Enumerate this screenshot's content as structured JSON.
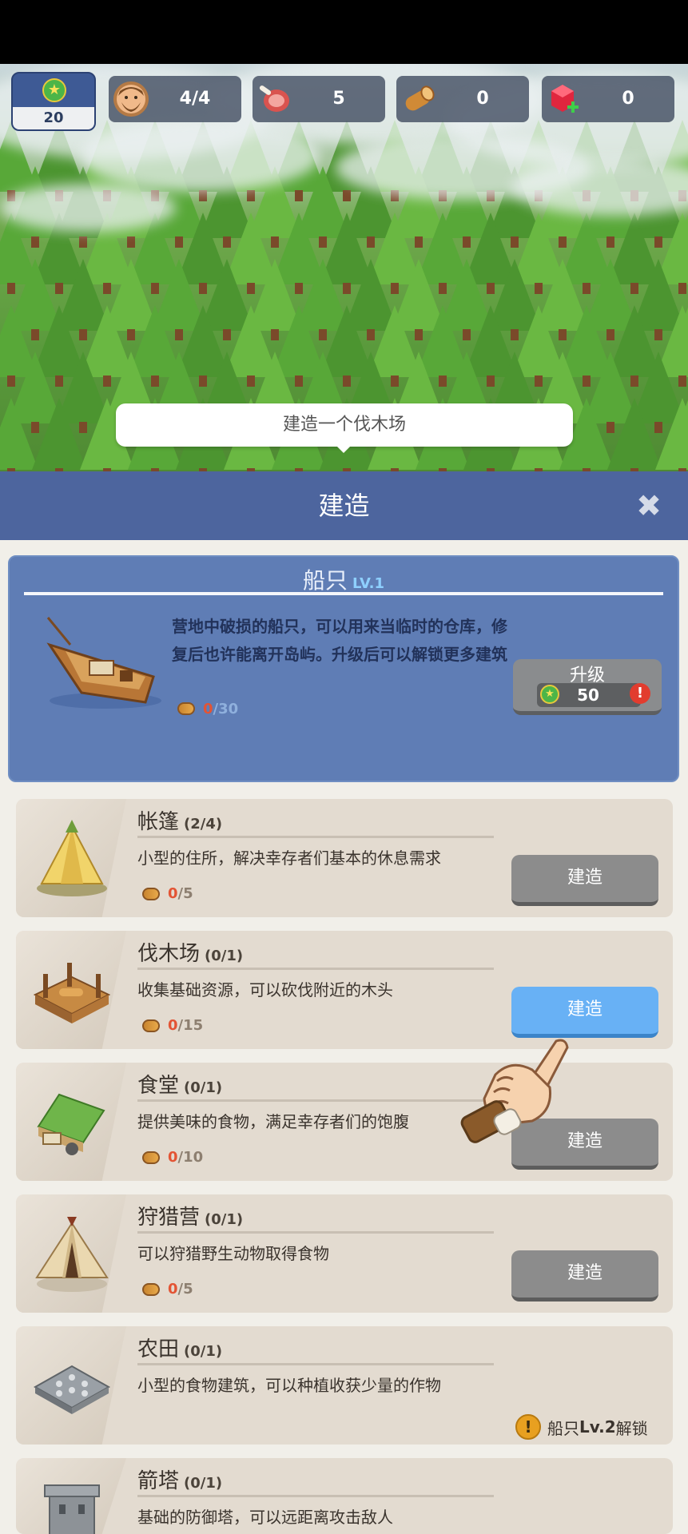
{
  "hud": {
    "level": "20",
    "resources": [
      {
        "icon": "survivor-icon",
        "value": "4/4"
      },
      {
        "icon": "meat-icon",
        "value": "5"
      },
      {
        "icon": "wood-icon",
        "value": "0"
      },
      {
        "icon": "gem-icon",
        "value": "0"
      }
    ]
  },
  "tooltip": "建造一个伐木场",
  "build_panel": {
    "title": "建造",
    "close_icon": "close-icon"
  },
  "boat": {
    "name": "船只",
    "level": "LV.1",
    "description": "营地中破损的船只，可以用来当临时的仓库，修复后也许能离开岛屿。升级后可以解锁更多建筑",
    "cost_have": "0",
    "cost_need": "/30",
    "upgrade_label": "升级",
    "upgrade_cost": "50"
  },
  "buildings": [
    {
      "name": "帐篷",
      "count": "(2/4)",
      "description": "小型的住所，解决幸存者们基本的休息需求",
      "cost_have": "0",
      "cost_need": "/5",
      "button": "建造",
      "active": false
    },
    {
      "name": "伐木场",
      "count": "(0/1)",
      "description": "收集基础资源，可以砍伐附近的木头",
      "cost_have": "0",
      "cost_need": "/15",
      "button": "建造",
      "active": true
    },
    {
      "name": "食堂",
      "count": "(0/1)",
      "description": "提供美味的食物，满足幸存者们的饱腹",
      "cost_have": "0",
      "cost_need": "/10",
      "button": "建造",
      "active": false
    },
    {
      "name": "狩猎营",
      "count": "(0/1)",
      "description": "可以狩猎野生动物取得食物",
      "cost_have": "0",
      "cost_need": "/5",
      "button": "建造",
      "active": false
    },
    {
      "name": "农田",
      "count": "(0/1)",
      "description": "小型的食物建筑，可以种植收获少量的作物",
      "lock_prefix": "船只",
      "lock_level": "Lv.2",
      "lock_suffix": "解锁"
    },
    {
      "name": "箭塔",
      "count": "(0/1)",
      "description": "基础的防御塔，可以远距离攻击敌人"
    }
  ],
  "colors": {
    "header": "#4d659e",
    "boat_card": "#5f7db5",
    "active_button": "#68b1f5",
    "disabled_button": "#8c8c8c",
    "cost_red": "#e35434"
  }
}
